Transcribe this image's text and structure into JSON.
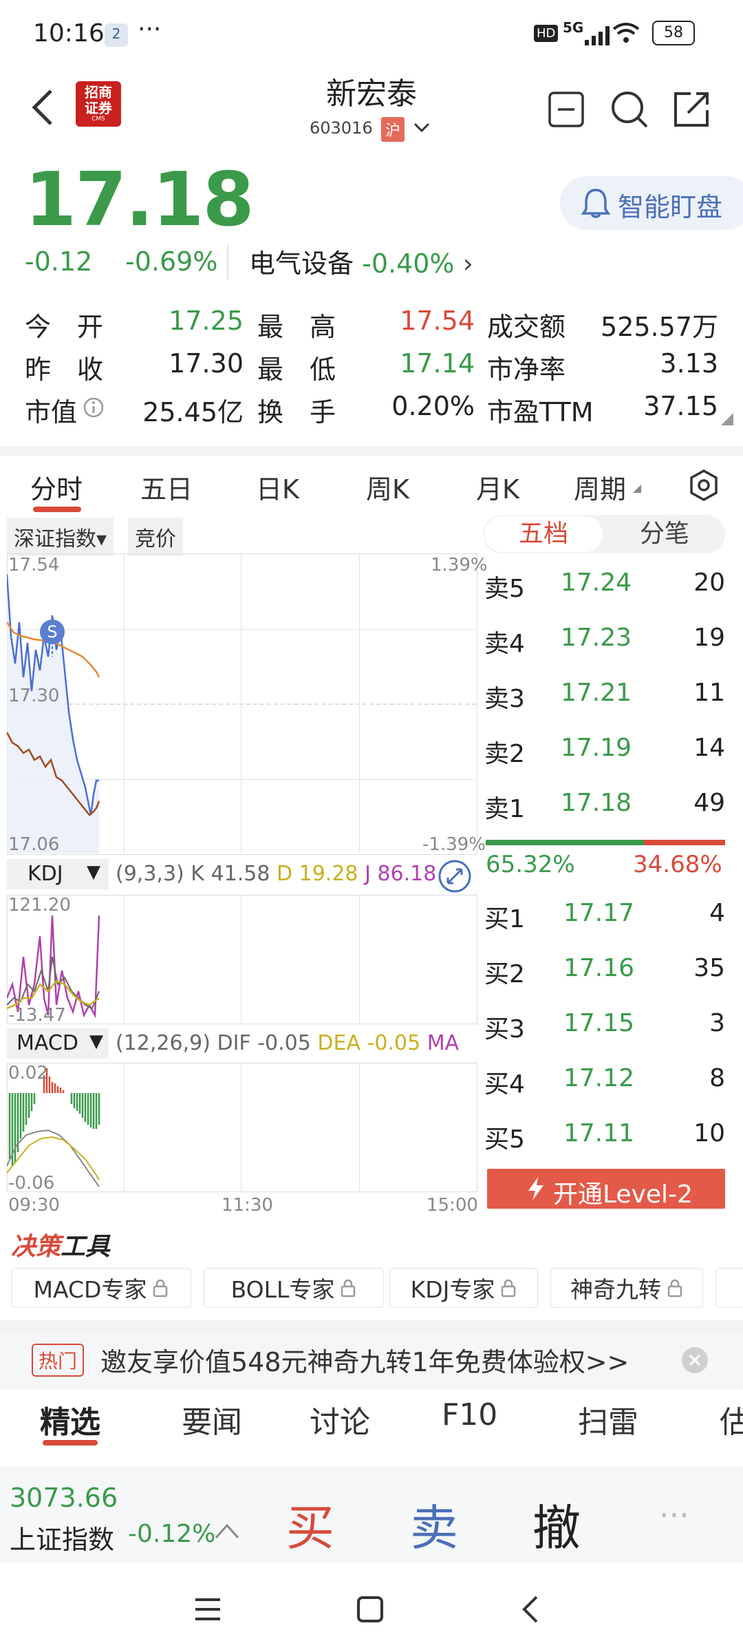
{
  "status": {
    "time": "10:16",
    "notif_badge": "2",
    "dots": "···",
    "hd": "HD",
    "net": "5G",
    "battery": "58"
  },
  "header": {
    "logo_top": "招商",
    "logo_bottom": "证券",
    "logo_cms": "CMS",
    "title": "新宏泰",
    "code": "603016",
    "market": "沪"
  },
  "quote": {
    "price": "17.18",
    "change": "-0.12",
    "change_pct": "-0.69%",
    "sector": "电气设备",
    "sector_pct": "-0.40%",
    "sector_arrow": "›",
    "smart_watch": "智能盯盘",
    "fields": [
      {
        "k": "今　开",
        "v": "17.25"
      },
      {
        "k": "最　高",
        "v": "17.54"
      },
      {
        "k": "成交额",
        "v": "525.57万"
      },
      {
        "k": "昨　收",
        "v": "17.30"
      },
      {
        "k": "最　低",
        "v": "17.14"
      },
      {
        "k": "市净率",
        "v": "3.13"
      },
      {
        "k": "市值",
        "v": "25.45亿"
      },
      {
        "k": "换　手",
        "v": "0.20%"
      },
      {
        "k": "市盈TTM",
        "v": "37.15"
      }
    ]
  },
  "tabs": [
    "分时",
    "五日",
    "日K",
    "周K",
    "月K",
    "周期"
  ],
  "chart": {
    "index_select": "深证指数▾",
    "auction": "竞价",
    "top_price": "17.54",
    "top_pct": "1.39%",
    "mid_price": "17.30",
    "bot_price": "17.06",
    "bot_pct": "-1.39%",
    "s_marker": "S",
    "kdj": {
      "name": "KDJ",
      "param": "(9,3,3)",
      "k_label": "K",
      "k": "41.58",
      "d_label": "D",
      "d": "19.28",
      "j_label": "J",
      "j": "86.18",
      "top": "121.20",
      "bot": "-13.47"
    },
    "macd": {
      "name": "MACD",
      "param": "(12,26,9)",
      "dif_label": "DIF",
      "dif": "-0.05",
      "dea_label": "DEA",
      "dea": "-0.05",
      "ma_label": "MA",
      "top": "0.02",
      "bot": "-0.06"
    },
    "times": [
      "09:30",
      "11:30",
      "15:00"
    ]
  },
  "book": {
    "tab_active": "五档",
    "tab_other": "分笔",
    "asks": [
      {
        "l": "卖5",
        "p": "17.24",
        "v": "20"
      },
      {
        "l": "卖4",
        "p": "17.23",
        "v": "19"
      },
      {
        "l": "卖3",
        "p": "17.21",
        "v": "11"
      },
      {
        "l": "卖2",
        "p": "17.19",
        "v": "14"
      },
      {
        "l": "卖1",
        "p": "17.18",
        "v": "49"
      }
    ],
    "ratio_left": "65.32%",
    "ratio_right": "34.68%",
    "bids": [
      {
        "l": "买1",
        "p": "17.17",
        "v": "4"
      },
      {
        "l": "买2",
        "p": "17.16",
        "v": "35"
      },
      {
        "l": "买3",
        "p": "17.15",
        "v": "3"
      },
      {
        "l": "买4",
        "p": "17.12",
        "v": "8"
      },
      {
        "l": "买5",
        "p": "17.11",
        "v": "10"
      }
    ],
    "level2": "开通Level-2"
  },
  "tools": {
    "title_a": "决策",
    "title_b": "工具",
    "items": [
      "MACD专家",
      "BOLL专家",
      "KDJ专家",
      "神奇九转"
    ]
  },
  "banner": {
    "tag": "热门",
    "text": "邀友享价值548元神奇九转1年免费体验权>>"
  },
  "bottom_tabs": [
    "精选",
    "要闻",
    "讨论",
    "F10",
    "扫雷",
    "估"
  ],
  "index_bar": {
    "value": "3073.66",
    "name": "上证指数",
    "pct": "-0.12%"
  },
  "actions": {
    "buy": "买",
    "sell": "卖",
    "cancel": "撤",
    "more": "···"
  },
  "colors": {
    "green": "#3a9a4a",
    "red": "#d84a3a",
    "blue": "#4a6fb8"
  }
}
